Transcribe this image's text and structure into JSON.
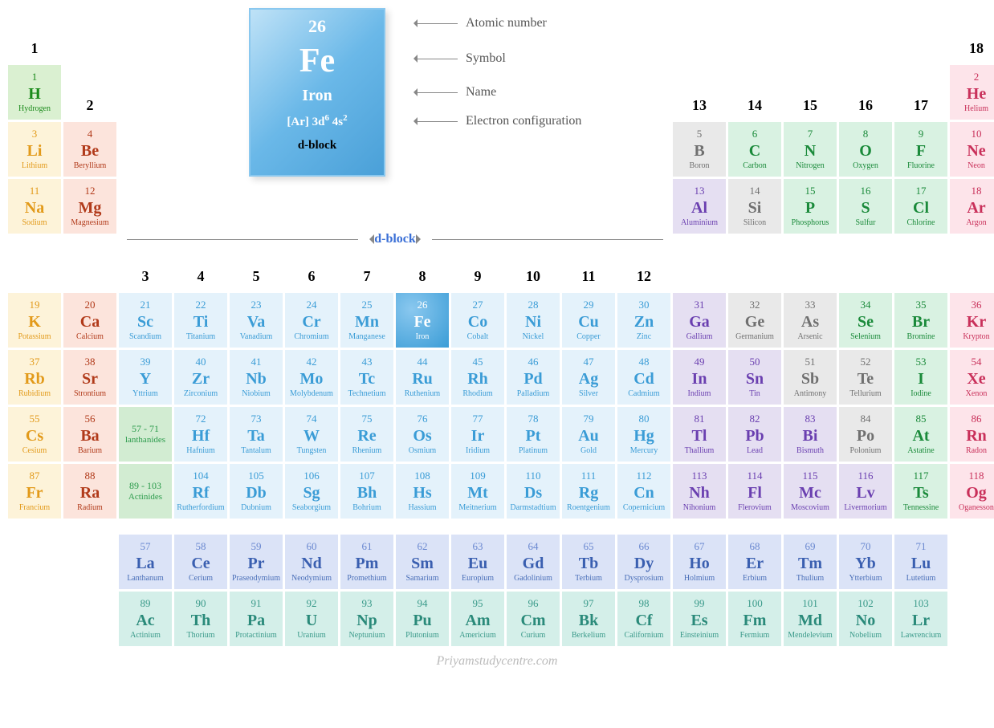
{
  "legend": {
    "number": "26",
    "symbol": "Fe",
    "name": "Iron",
    "econf_html": "[Ar] 3d<sup>6</sup> 4s<sup>2</sup>",
    "block": "d-block",
    "labels": {
      "atomic_number": "Atomic number",
      "symbol": "Symbol",
      "name": "Name",
      "econf": "Electron configuration"
    }
  },
  "dblock_label": "d-block",
  "group_headers": [
    "1",
    "2",
    "3",
    "4",
    "5",
    "6",
    "7",
    "8",
    "9",
    "10",
    "11",
    "12",
    "13",
    "14",
    "15",
    "16",
    "17",
    "18"
  ],
  "lan_range": "57 - 71",
  "lan_range_label": "lanthanides",
  "act_range": "89 - 103",
  "act_range_label": "Actinides",
  "watermark": "Priyamstudycentre.com",
  "elements": [
    {
      "n": "1",
      "s": "H",
      "name": "Hydrogen",
      "cls": "h",
      "row": 2,
      "col": 1
    },
    {
      "n": "2",
      "s": "He",
      "name": "Helium",
      "cls": "noble",
      "row": 2,
      "col": 18
    },
    {
      "n": "3",
      "s": "Li",
      "name": "Lithium",
      "cls": "alk",
      "row": 3,
      "col": 1
    },
    {
      "n": "4",
      "s": "Be",
      "name": "Beryllium",
      "cls": "aearth",
      "row": 3,
      "col": 2
    },
    {
      "n": "5",
      "s": "B",
      "name": "Boron",
      "cls": "mld",
      "row": 3,
      "col": 13
    },
    {
      "n": "6",
      "s": "C",
      "name": "Carbon",
      "cls": "nm1",
      "row": 3,
      "col": 14
    },
    {
      "n": "7",
      "s": "N",
      "name": "Nitrogen",
      "cls": "nm1",
      "row": 3,
      "col": 15
    },
    {
      "n": "8",
      "s": "O",
      "name": "Oxygen",
      "cls": "nm1",
      "row": 3,
      "col": 16
    },
    {
      "n": "9",
      "s": "F",
      "name": "Fluorine",
      "cls": "hal",
      "row": 3,
      "col": 17
    },
    {
      "n": "10",
      "s": "Ne",
      "name": "Neon",
      "cls": "noble",
      "row": 3,
      "col": 18
    },
    {
      "n": "11",
      "s": "Na",
      "name": "Sodium",
      "cls": "alk",
      "row": 4,
      "col": 1
    },
    {
      "n": "12",
      "s": "Mg",
      "name": "Magnesium",
      "cls": "aearth",
      "row": 4,
      "col": 2
    },
    {
      "n": "13",
      "s": "Al",
      "name": "Aluminium",
      "cls": "ptm",
      "row": 4,
      "col": 13
    },
    {
      "n": "14",
      "s": "Si",
      "name": "Silicon",
      "cls": "mld",
      "row": 4,
      "col": 14
    },
    {
      "n": "15",
      "s": "P",
      "name": "Phosphorus",
      "cls": "nm1",
      "row": 4,
      "col": 15
    },
    {
      "n": "16",
      "s": "S",
      "name": "Sulfur",
      "cls": "nm1",
      "row": 4,
      "col": 16
    },
    {
      "n": "17",
      "s": "Cl",
      "name": "Chlorine",
      "cls": "hal",
      "row": 4,
      "col": 17
    },
    {
      "n": "18",
      "s": "Ar",
      "name": "Argon",
      "cls": "noble",
      "row": 4,
      "col": 18
    },
    {
      "n": "19",
      "s": "K",
      "name": "Potassium",
      "cls": "alk",
      "row": 6,
      "col": 1
    },
    {
      "n": "20",
      "s": "Ca",
      "name": "Calcium",
      "cls": "aearth",
      "row": 6,
      "col": 2
    },
    {
      "n": "21",
      "s": "Sc",
      "name": "Scandium",
      "cls": "tm",
      "row": 6,
      "col": 3
    },
    {
      "n": "22",
      "s": "Ti",
      "name": "Titanium",
      "cls": "tm",
      "row": 6,
      "col": 4
    },
    {
      "n": "23",
      "s": "Va",
      "name": "Vanadium",
      "cls": "tm",
      "row": 6,
      "col": 5
    },
    {
      "n": "24",
      "s": "Cr",
      "name": "Chromium",
      "cls": "tm",
      "row": 6,
      "col": 6
    },
    {
      "n": "25",
      "s": "Mn",
      "name": "Manganese",
      "cls": "tm",
      "row": 6,
      "col": 7
    },
    {
      "n": "26",
      "s": "Fe",
      "name": "Iron",
      "cls": "tm fe-highlight",
      "row": 6,
      "col": 8
    },
    {
      "n": "27",
      "s": "Co",
      "name": "Cobalt",
      "cls": "tm",
      "row": 6,
      "col": 9
    },
    {
      "n": "28",
      "s": "Ni",
      "name": "Nickel",
      "cls": "tm",
      "row": 6,
      "col": 10
    },
    {
      "n": "29",
      "s": "Cu",
      "name": "Copper",
      "cls": "tm",
      "row": 6,
      "col": 11
    },
    {
      "n": "30",
      "s": "Zn",
      "name": "Zinc",
      "cls": "tm",
      "row": 6,
      "col": 12
    },
    {
      "n": "31",
      "s": "Ga",
      "name": "Gallium",
      "cls": "ptm",
      "row": 6,
      "col": 13
    },
    {
      "n": "32",
      "s": "Ge",
      "name": "Germanium",
      "cls": "mld",
      "row": 6,
      "col": 14
    },
    {
      "n": "33",
      "s": "As",
      "name": "Arsenic",
      "cls": "mld",
      "row": 6,
      "col": 15
    },
    {
      "n": "34",
      "s": "Se",
      "name": "Selenium",
      "cls": "nm1",
      "row": 6,
      "col": 16
    },
    {
      "n": "35",
      "s": "Br",
      "name": "Bromine",
      "cls": "hal",
      "row": 6,
      "col": 17
    },
    {
      "n": "36",
      "s": "Kr",
      "name": "Krypton",
      "cls": "noble",
      "row": 6,
      "col": 18
    },
    {
      "n": "37",
      "s": "Rb",
      "name": "Rubidium",
      "cls": "alk",
      "row": 7,
      "col": 1
    },
    {
      "n": "38",
      "s": "Sr",
      "name": "Strontium",
      "cls": "aearth",
      "row": 7,
      "col": 2
    },
    {
      "n": "39",
      "s": "Y",
      "name": "Yttrium",
      "cls": "tm",
      "row": 7,
      "col": 3
    },
    {
      "n": "40",
      "s": "Zr",
      "name": "Zirconium",
      "cls": "tm",
      "row": 7,
      "col": 4
    },
    {
      "n": "41",
      "s": "Nb",
      "name": "Niobium",
      "cls": "tm",
      "row": 7,
      "col": 5
    },
    {
      "n": "42",
      "s": "Mo",
      "name": "Molybdenum",
      "cls": "tm",
      "row": 7,
      "col": 6
    },
    {
      "n": "43",
      "s": "Tc",
      "name": "Technetium",
      "cls": "tm",
      "row": 7,
      "col": 7
    },
    {
      "n": "44",
      "s": "Ru",
      "name": "Ruthenium",
      "cls": "tm",
      "row": 7,
      "col": 8
    },
    {
      "n": "45",
      "s": "Rh",
      "name": "Rhodium",
      "cls": "tm",
      "row": 7,
      "col": 9
    },
    {
      "n": "46",
      "s": "Pd",
      "name": "Palladium",
      "cls": "tm",
      "row": 7,
      "col": 10
    },
    {
      "n": "47",
      "s": "Ag",
      "name": "Silver",
      "cls": "tm",
      "row": 7,
      "col": 11
    },
    {
      "n": "48",
      "s": "Cd",
      "name": "Cadmium",
      "cls": "tm",
      "row": 7,
      "col": 12
    },
    {
      "n": "49",
      "s": "In",
      "name": "Indium",
      "cls": "ptm",
      "row": 7,
      "col": 13
    },
    {
      "n": "50",
      "s": "Sn",
      "name": "Tin",
      "cls": "ptm",
      "row": 7,
      "col": 14
    },
    {
      "n": "51",
      "s": "Sb",
      "name": "Antimony",
      "cls": "mld",
      "row": 7,
      "col": 15
    },
    {
      "n": "52",
      "s": "Te",
      "name": "Tellurium",
      "cls": "mld",
      "row": 7,
      "col": 16
    },
    {
      "n": "53",
      "s": "I",
      "name": "Iodine",
      "cls": "hal",
      "row": 7,
      "col": 17
    },
    {
      "n": "54",
      "s": "Xe",
      "name": "Xenon",
      "cls": "noble",
      "row": 7,
      "col": 18
    },
    {
      "n": "55",
      "s": "Cs",
      "name": "Cesium",
      "cls": "alk",
      "row": 8,
      "col": 1
    },
    {
      "n": "56",
      "s": "Ba",
      "name": "Barium",
      "cls": "aearth",
      "row": 8,
      "col": 2
    },
    {
      "n": "72",
      "s": "Hf",
      "name": "Hafnium",
      "cls": "tm",
      "row": 8,
      "col": 4
    },
    {
      "n": "73",
      "s": "Ta",
      "name": "Tantalum",
      "cls": "tm",
      "row": 8,
      "col": 5
    },
    {
      "n": "74",
      "s": "W",
      "name": "Tungsten",
      "cls": "tm",
      "row": 8,
      "col": 6
    },
    {
      "n": "75",
      "s": "Re",
      "name": "Rhenium",
      "cls": "tm",
      "row": 8,
      "col": 7
    },
    {
      "n": "76",
      "s": "Os",
      "name": "Osmium",
      "cls": "tm",
      "row": 8,
      "col": 8
    },
    {
      "n": "77",
      "s": "Ir",
      "name": "Iridium",
      "cls": "tm",
      "row": 8,
      "col": 9
    },
    {
      "n": "78",
      "s": "Pt",
      "name": "Platinum",
      "cls": "tm",
      "row": 8,
      "col": 10
    },
    {
      "n": "79",
      "s": "Au",
      "name": "Gold",
      "cls": "tm",
      "row": 8,
      "col": 11
    },
    {
      "n": "80",
      "s": "Hg",
      "name": "Mercury",
      "cls": "tm",
      "row": 8,
      "col": 12
    },
    {
      "n": "81",
      "s": "Tl",
      "name": "Thallium",
      "cls": "ptm",
      "row": 8,
      "col": 13
    },
    {
      "n": "82",
      "s": "Pb",
      "name": "Lead",
      "cls": "ptm",
      "row": 8,
      "col": 14
    },
    {
      "n": "83",
      "s": "Bi",
      "name": "Bismuth",
      "cls": "ptm",
      "row": 8,
      "col": 15
    },
    {
      "n": "84",
      "s": "Po",
      "name": "Polonium",
      "cls": "mld",
      "row": 8,
      "col": 16
    },
    {
      "n": "85",
      "s": "At",
      "name": "Astatine",
      "cls": "hal",
      "row": 8,
      "col": 17
    },
    {
      "n": "86",
      "s": "Rn",
      "name": "Radon",
      "cls": "noble",
      "row": 8,
      "col": 18
    },
    {
      "n": "87",
      "s": "Fr",
      "name": "Francium",
      "cls": "alk",
      "row": 9,
      "col": 1
    },
    {
      "n": "88",
      "s": "Ra",
      "name": "Radium",
      "cls": "aearth",
      "row": 9,
      "col": 2
    },
    {
      "n": "104",
      "s": "Rf",
      "name": "Rutherfordium",
      "cls": "tm",
      "row": 9,
      "col": 4
    },
    {
      "n": "105",
      "s": "Db",
      "name": "Dubnium",
      "cls": "tm",
      "row": 9,
      "col": 5
    },
    {
      "n": "106",
      "s": "Sg",
      "name": "Seaborgium",
      "cls": "tm",
      "row": 9,
      "col": 6
    },
    {
      "n": "107",
      "s": "Bh",
      "name": "Bohrium",
      "cls": "tm",
      "row": 9,
      "col": 7
    },
    {
      "n": "108",
      "s": "Hs",
      "name": "Hassium",
      "cls": "tm",
      "row": 9,
      "col": 8
    },
    {
      "n": "109",
      "s": "Mt",
      "name": "Meitnerium",
      "cls": "tm",
      "row": 9,
      "col": 9
    },
    {
      "n": "110",
      "s": "Ds",
      "name": "Darmstadtium",
      "cls": "tm",
      "row": 9,
      "col": 10
    },
    {
      "n": "111",
      "s": "Rg",
      "name": "Roentgenium",
      "cls": "tm",
      "row": 9,
      "col": 11
    },
    {
      "n": "112",
      "s": "Cn",
      "name": "Copernicium",
      "cls": "tm",
      "row": 9,
      "col": 12
    },
    {
      "n": "113",
      "s": "Nh",
      "name": "Nihonium",
      "cls": "ptm",
      "row": 9,
      "col": 13
    },
    {
      "n": "114",
      "s": "Fl",
      "name": "Flerovium",
      "cls": "ptm",
      "row": 9,
      "col": 14
    },
    {
      "n": "115",
      "s": "Mc",
      "name": "Moscovium",
      "cls": "ptm",
      "row": 9,
      "col": 15
    },
    {
      "n": "116",
      "s": "Lv",
      "name": "Livermorium",
      "cls": "ptm",
      "row": 9,
      "col": 16
    },
    {
      "n": "117",
      "s": "Ts",
      "name": "Tennessine",
      "cls": "hal",
      "row": 9,
      "col": 17
    },
    {
      "n": "118",
      "s": "Og",
      "name": "Oganesson",
      "cls": "noble",
      "row": 9,
      "col": 18
    }
  ],
  "lanthanides": [
    {
      "n": "57",
      "s": "La",
      "name": "Lanthanum"
    },
    {
      "n": "58",
      "s": "Ce",
      "name": "Cerium"
    },
    {
      "n": "59",
      "s": "Pr",
      "name": "Praseodymium"
    },
    {
      "n": "60",
      "s": "Nd",
      "name": "Neodymium"
    },
    {
      "n": "61",
      "s": "Pm",
      "name": "Promethium"
    },
    {
      "n": "62",
      "s": "Sm",
      "name": "Samarium"
    },
    {
      "n": "63",
      "s": "Eu",
      "name": "Europium"
    },
    {
      "n": "64",
      "s": "Gd",
      "name": "Gadolinium"
    },
    {
      "n": "65",
      "s": "Tb",
      "name": "Terbium"
    },
    {
      "n": "66",
      "s": "Dy",
      "name": "Dysprosium"
    },
    {
      "n": "67",
      "s": "Ho",
      "name": "Holmium"
    },
    {
      "n": "68",
      "s": "Er",
      "name": "Erbium"
    },
    {
      "n": "69",
      "s": "Tm",
      "name": "Thulium"
    },
    {
      "n": "70",
      "s": "Yb",
      "name": "Ytterbium"
    },
    {
      "n": "71",
      "s": "Lu",
      "name": "Lutetium"
    }
  ],
  "actinides": [
    {
      "n": "89",
      "s": "Ac",
      "name": "Actinium"
    },
    {
      "n": "90",
      "s": "Th",
      "name": "Thorium"
    },
    {
      "n": "91",
      "s": "Pa",
      "name": "Protactinium"
    },
    {
      "n": "92",
      "s": "U",
      "name": "Uranium"
    },
    {
      "n": "93",
      "s": "Np",
      "name": "Neptunium"
    },
    {
      "n": "94",
      "s": "Pu",
      "name": "Plutonium"
    },
    {
      "n": "95",
      "s": "Am",
      "name": "Americium"
    },
    {
      "n": "96",
      "s": "Cm",
      "name": "Curium"
    },
    {
      "n": "97",
      "s": "Bk",
      "name": "Berkelium"
    },
    {
      "n": "98",
      "s": "Cf",
      "name": "Californium"
    },
    {
      "n": "99",
      "s": "Es",
      "name": "Einsteinium"
    },
    {
      "n": "100",
      "s": "Fm",
      "name": "Fermium"
    },
    {
      "n": "101",
      "s": "Md",
      "name": "Mendelevium"
    },
    {
      "n": "102",
      "s": "No",
      "name": "Nobelium"
    },
    {
      "n": "103",
      "s": "Lr",
      "name": "Lawrencium"
    }
  ]
}
